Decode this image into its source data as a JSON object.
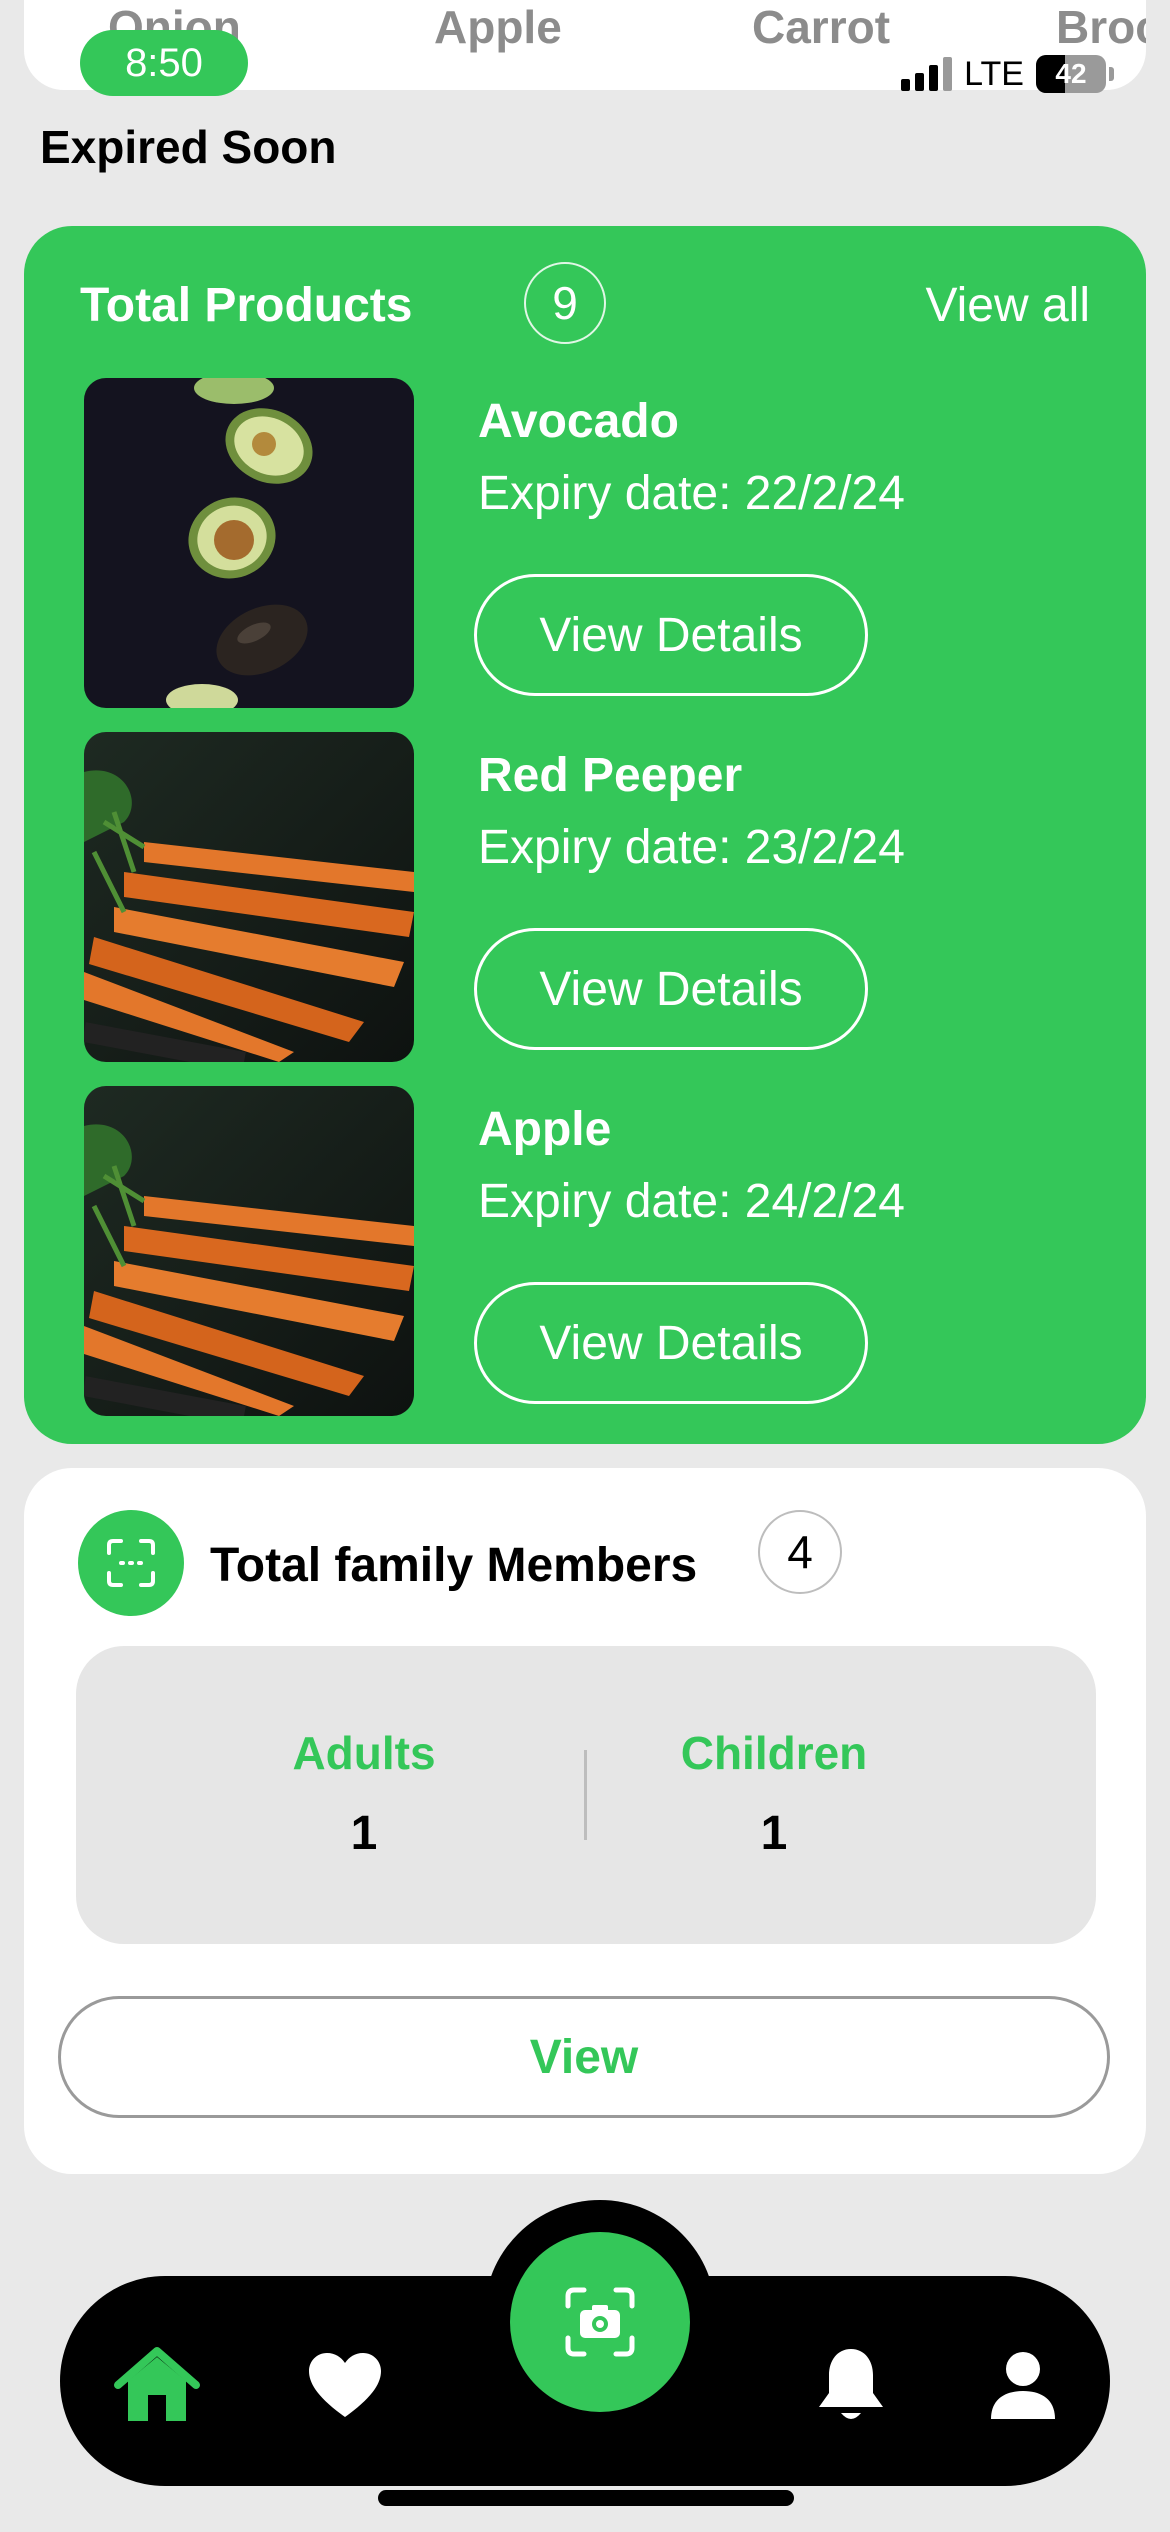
{
  "status_bar": {
    "time": "8:50",
    "network": "LTE",
    "battery": "42",
    "battery_level_percent": 42
  },
  "categories": [
    "Onion",
    "Apple",
    "Carrot",
    "Broc"
  ],
  "section_title": "Expired Soon",
  "products_card": {
    "title": "Total Products",
    "count": "9",
    "view_all": "View all",
    "items": [
      {
        "name": "Avocado",
        "expiry": "Expiry date: 22/2/24",
        "button": "View Details",
        "image": "avocado-photo"
      },
      {
        "name": "Red Peeper",
        "expiry": "Expiry date: 23/2/24",
        "button": "View Details",
        "image": "carrots-photo"
      },
      {
        "name": "Apple",
        "expiry": "Expiry date: 24/2/24",
        "button": "View Details",
        "image": "carrots-photo"
      }
    ]
  },
  "family_card": {
    "title": "Total family Members",
    "count": "4",
    "adults_label": "Adults",
    "adults_value": "1",
    "children_label": "Children",
    "children_value": "1",
    "view_button": "View"
  },
  "nav": {
    "items": [
      "home-icon",
      "heart-icon",
      "camera-scan-icon",
      "bell-icon",
      "profile-icon"
    ],
    "active": "home-icon"
  },
  "colors": {
    "accent": "#34c759",
    "background": "#e9e9e9",
    "nav_background": "#000000"
  }
}
